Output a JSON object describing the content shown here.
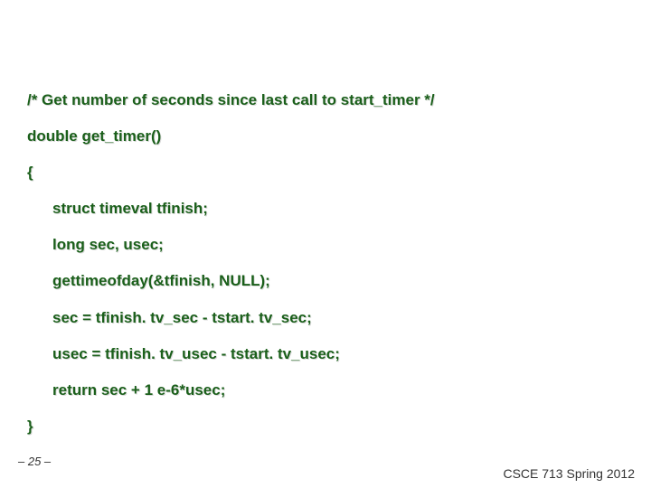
{
  "code": {
    "line1": "/* Get number of seconds since last call to start_timer */",
    "line2": "double get_timer()",
    "line3": "{",
    "line4": "struct timeval tfinish;",
    "line5": "long sec, usec;",
    "line6": "gettimeofday(&tfinish, NULL);",
    "line7": "sec = tfinish. tv_sec - tstart. tv_sec;",
    "line8": "usec = tfinish. tv_usec - tstart. tv_usec;",
    "line9": "return sec + 1 e-6*usec;",
    "line10": "}"
  },
  "footer": {
    "page": "– 25 –",
    "course": "CSCE 713 Spring 2012"
  }
}
